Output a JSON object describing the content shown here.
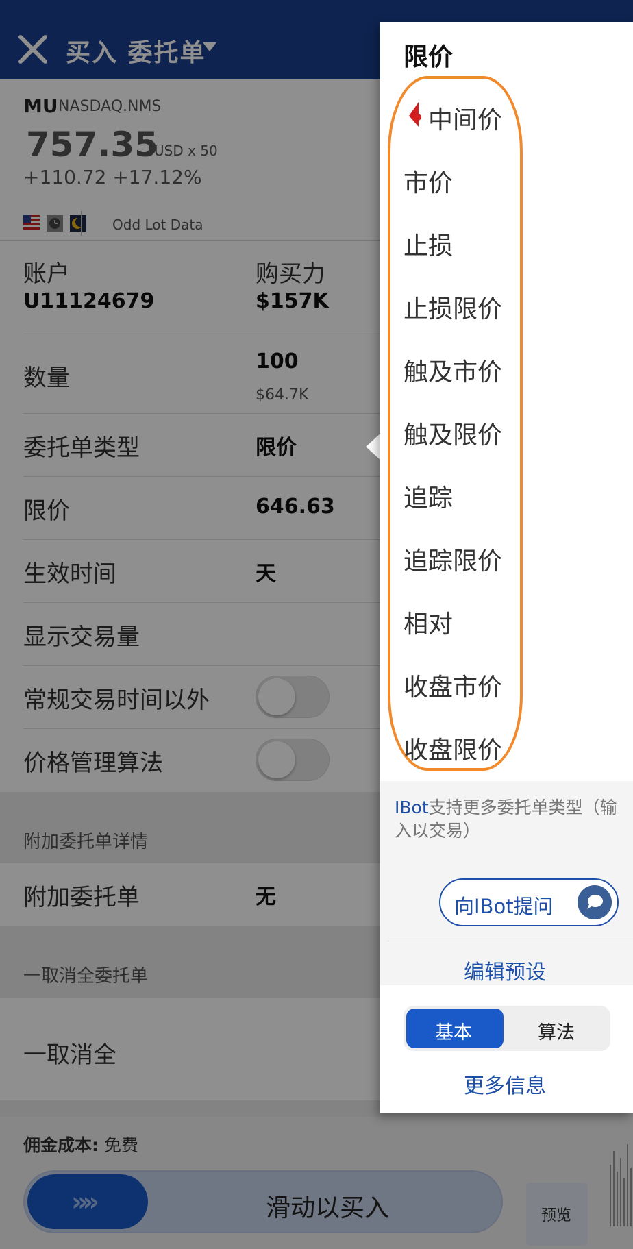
{
  "header": {
    "title": "买入 委托单"
  },
  "quote": {
    "symbol": "MU",
    "exchange": "NASDAQ.NMS",
    "price": "757.35",
    "currency_multiplier": "USD x 50",
    "change": "+110.72 +17.12%",
    "odd_lot": "Odd Lot Data"
  },
  "form": {
    "account_label": "账户",
    "account_value": "U11124679",
    "buying_power_label": "购买力",
    "buying_power_value": "$157K",
    "quantity_label": "数量",
    "quantity_value": "100",
    "quantity_amount": "$64.7K",
    "order_type_label": "委托单类型",
    "order_type_value": "限价",
    "limit_price_label": "限价",
    "limit_price_value": "646.63",
    "tif_label": "生效时间",
    "tif_value": "天",
    "display_size_label": "显示交易量",
    "outside_rth_label": "常规交易时间以外",
    "outside_rth_on": false,
    "price_mgmt_label": "价格管理算法",
    "price_mgmt_on": false,
    "attached_section_title": "附加委托单详情",
    "attached_label": "附加委托单",
    "attached_value": "无",
    "oca_section_title": "一取消全委托单",
    "oca_label": "一取消全"
  },
  "bottom": {
    "commission_label": "佣金成本:",
    "commission_value": "免费",
    "slide_text": "滑动以买入",
    "slide_arrows": "»»",
    "preview_label": "预览"
  },
  "order_type_menu": {
    "selected": "限价",
    "options": [
      "中间价",
      "市价",
      "止损",
      "止损限价",
      "触及市价",
      "触及限价",
      "追踪",
      "追踪限价",
      "相对",
      "收盘市价",
      "收盘限价"
    ],
    "ibot_brand": "IBot",
    "ibot_hint": "支持更多委托单类型（输入以交易）",
    "ask_ibot": "向IBot提问",
    "edit_presets": "编辑预设",
    "mode_basic": "基本",
    "mode_algo": "算法",
    "mode_selected": "基本",
    "more_info": "更多信息"
  },
  "colors": {
    "header_bg": "#1a3f8f",
    "accent_blue": "#1a5ac8",
    "link_blue": "#1e50a8",
    "highlight_orange": "#f08a2c"
  }
}
